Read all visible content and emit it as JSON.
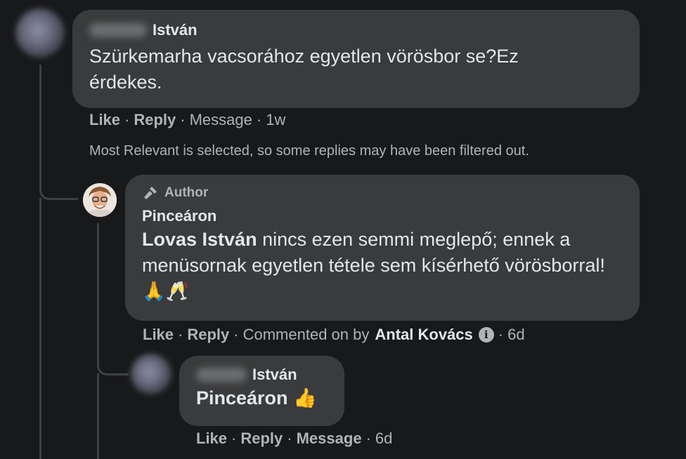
{
  "comment1": {
    "name": "István",
    "text": "Szürkemarha vacsorához egyetlen vörösbor se?Ez érdekes.",
    "actions": {
      "like": "Like",
      "reply": "Reply",
      "message": "Message",
      "time": "1w"
    }
  },
  "filter_notice": "Most Relevant is selected, so some replies may have been filtered out.",
  "reply1": {
    "badge": "Author",
    "name": "Pinceáron",
    "mention": "Lovas István",
    "text": " nincs ezen semmi meglepő; ennek a menüsornak egyetlen tétele sem kísérhető vörösborral! 🙏🥂",
    "actions": {
      "like": "Like",
      "reply": "Reply",
      "commented_on_by": "Commented on by",
      "commenter": "Antal Kovács",
      "time": "6d"
    }
  },
  "reply2": {
    "name": "István",
    "text": "Pinceáron 👍",
    "actions": {
      "like": "Like",
      "reply": "Reply",
      "message": "Message",
      "time": "6d"
    }
  },
  "colors": {
    "background": "#18191a",
    "bubble": "#3a3b3c",
    "text": "#e4e6eb",
    "secondary": "#b0b3b8"
  }
}
